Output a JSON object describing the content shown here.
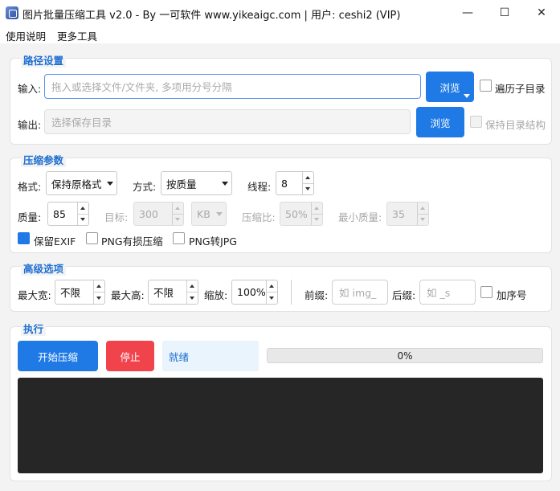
{
  "window": {
    "title": "图片批量压缩工具 v2.0 - By 一可软件 www.yikeaigc.com  |  用户: ceshi2 (VIP)",
    "minimize_glyph": "—",
    "maximize_glyph": "☐",
    "close_glyph": "✕"
  },
  "menu": {
    "help": "使用说明",
    "more_tools": "更多工具"
  },
  "path_group": {
    "title": "路径设置",
    "input_label": "输入:",
    "input_placeholder": "拖入或选择文件/文件夹, 多项用分号分隔",
    "input_value": "",
    "browse_input": "浏览",
    "recurse_label": "遍历子目录",
    "recurse_checked": false,
    "output_label": "输出:",
    "output_placeholder": "选择保存目录",
    "output_value": "",
    "browse_output": "浏览",
    "keep_structure_label": "保持目录结构",
    "keep_structure_checked": false
  },
  "params_group": {
    "title": "压缩参数",
    "format_label": "格式:",
    "format_value": "保持原格式",
    "mode_label": "方式:",
    "mode_value": "按质量",
    "threads_label": "线程:",
    "threads_value": "8",
    "quality_label": "质量:",
    "quality_value": "85",
    "target_label": "目标:",
    "target_value": "300",
    "target_unit": "KB",
    "ratio_label": "压缩比:",
    "ratio_value": "50%",
    "min_quality_label": "最小质量:",
    "min_quality_value": "35",
    "keep_exif_label": "保留EXIF",
    "keep_exif_checked": true,
    "png_lossy_label": "PNG有损压缩",
    "png_lossy_checked": false,
    "png_to_jpg_label": "PNG转JPG",
    "png_to_jpg_checked": false
  },
  "advanced_group": {
    "title": "高级选项",
    "max_width_label": "最大宽:",
    "max_width_value": "不限",
    "max_height_label": "最大高:",
    "max_height_value": "不限",
    "scale_label": "缩放:",
    "scale_value": "100%",
    "prefix_label": "前缀:",
    "prefix_placeholder": "如 img_",
    "suffix_label": "后缀:",
    "suffix_placeholder": "如 _s",
    "seq_label": "加序号",
    "seq_checked": false
  },
  "exec_group": {
    "title": "执行",
    "start_button": "开始压缩",
    "stop_button": "停止",
    "status_text": "就绪",
    "progress_text": "0%",
    "progress_fraction": 0,
    "log_text": ""
  },
  "colors": {
    "accent": "#1f7ae6",
    "danger": "#f0434c",
    "group_title": "#1f6fd1",
    "log_background": "#262626"
  }
}
